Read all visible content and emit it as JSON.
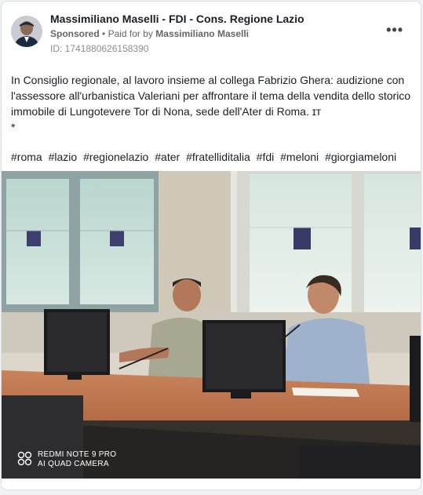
{
  "post": {
    "author": "Massimiliano Maselli - FDI - Cons. Regione Lazio",
    "sponsored_label": "Sponsored",
    "separator": "•",
    "paid_for_prefix": "Paid for by",
    "paid_for_name": "Massimiliano Maselli",
    "id_line": "ID: 1741880626158390",
    "more_label": "•••",
    "text_line1": "In Consiglio regionale, al lavoro insieme al collega Fabrizio Ghera: audizione con l'assessore all'urbanistica Valeriani per affrontare il tema della vendita dello storico immobile di Lungotevere Tor di Nona, sede dell'Ater di Roma. ɪᴛ",
    "text_line2": "*",
    "hashtags": [
      "#roma",
      "#lazio",
      "#regionelazio",
      "#ater",
      "#fratelliditalia",
      "#fdi",
      "#meloni",
      "#giorgiameloni"
    ]
  },
  "image": {
    "watermark_line1": "REDMI NOTE 9 PRO",
    "watermark_line2": "AI QUAD CAMERA",
    "watermark_icon": "camera-dots-icon"
  }
}
